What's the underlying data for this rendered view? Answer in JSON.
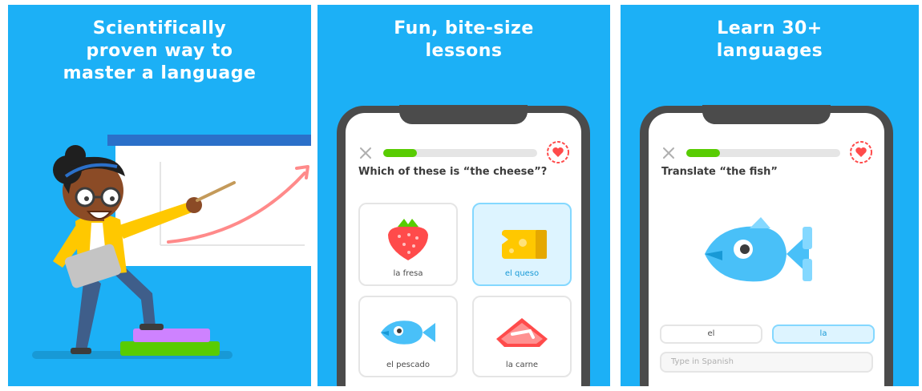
{
  "panels": [
    {
      "headline": [
        "Scientifically",
        "proven way to",
        "master a language"
      ]
    },
    {
      "headline": [
        "Fun, bite-size",
        "lessons"
      ],
      "lesson": {
        "progress_percent": 22,
        "question": "Which of these is “the cheese”?",
        "options": [
          {
            "label": "la fresa",
            "icon": "strawberry-icon",
            "selected": false
          },
          {
            "label": "el queso",
            "icon": "cheese-icon",
            "selected": true
          },
          {
            "label": "el pescado",
            "icon": "fish-icon",
            "selected": false
          },
          {
            "label": "la carne",
            "icon": "meat-icon",
            "selected": false
          }
        ]
      }
    },
    {
      "headline": [
        "Learn 30+",
        "languages"
      ],
      "lesson": {
        "progress_percent": 22,
        "question": "Translate “the fish”",
        "word_bank": [
          {
            "label": "el",
            "selected": false
          },
          {
            "label": "la",
            "selected": true
          }
        ],
        "input_placeholder": "Type in Spanish"
      }
    }
  ],
  "colors": {
    "panel_bg": "#1cb0f6",
    "progress": "#58cc02",
    "heart": "#ff4b4b",
    "selected_bg": "#ddf4ff",
    "selected_text": "#1899d6"
  }
}
